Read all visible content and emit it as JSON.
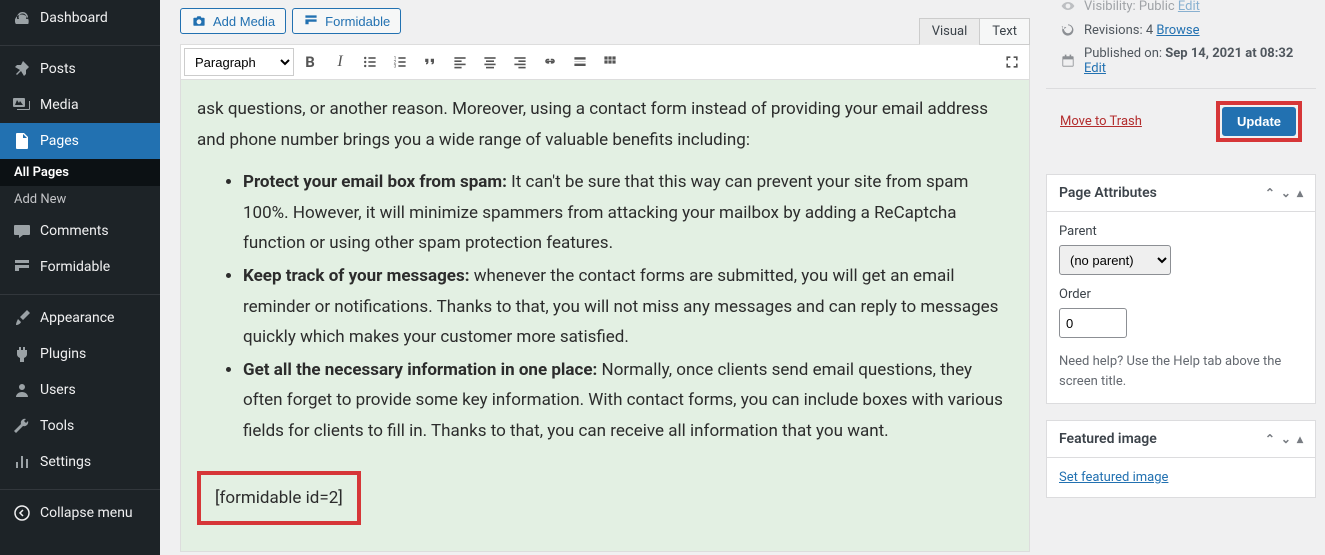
{
  "sidebar": {
    "items": [
      {
        "label": "Dashboard",
        "icon": "dashboard"
      },
      {
        "label": "Posts",
        "icon": "pin"
      },
      {
        "label": "Media",
        "icon": "media"
      },
      {
        "label": "Pages",
        "icon": "pages",
        "active": true
      },
      {
        "label": "Comments",
        "icon": "comment"
      },
      {
        "label": "Formidable",
        "icon": "formidable"
      },
      {
        "label": "Appearance",
        "icon": "brush"
      },
      {
        "label": "Plugins",
        "icon": "plug"
      },
      {
        "label": "Users",
        "icon": "user"
      },
      {
        "label": "Tools",
        "icon": "wrench"
      },
      {
        "label": "Settings",
        "icon": "settings"
      },
      {
        "label": "Collapse menu",
        "icon": "collapse"
      }
    ],
    "submenu": [
      "All Pages",
      "Add New"
    ]
  },
  "editor": {
    "add_media_label": "Add Media",
    "formidable_label": "Formidable",
    "tabs": {
      "visual": "Visual",
      "text": "Text"
    },
    "format_select": "Paragraph",
    "content": {
      "intro": "ask questions, or another reason. Moreover, using a contact form instead of providing your email address and phone number brings you a wide range of valuable benefits including:",
      "bullets": [
        {
          "bold": "Protect your email box from spam:",
          "text": " It can't be sure that this way can prevent your site from spam 100%. However, it will minimize spammers from attacking your mailbox by adding a ReCaptcha function or using other spam protection features."
        },
        {
          "bold": "Keep track of your messages:",
          "text": " whenever the contact forms are submitted, you will get an email reminder or notifications. Thanks to that, you will not miss any messages and can reply to messages quickly which makes your customer more satisfied."
        },
        {
          "bold": "Get all the necessary information in one place:",
          "text": " Normally, once clients send email questions, they often forget to provide some key information. With contact forms, you can include boxes with various fields for clients to fill in. Thanks to that, you can receive all information that you want."
        }
      ],
      "shortcode": "[formidable id=2]"
    }
  },
  "publish": {
    "visibility_label": "Visibility: ",
    "visibility_value": "Public",
    "edit_link": "Edit",
    "revisions_label": "Revisions: ",
    "revisions_count": "4",
    "browse_link": "Browse",
    "published_label": "Published on: ",
    "published_date": "Sep 14, 2021 at 08:32",
    "trash_label": "Move to Trash",
    "update_label": "Update"
  },
  "attributes": {
    "title": "Page Attributes",
    "parent_label": "Parent",
    "parent_value": "(no parent)",
    "order_label": "Order",
    "order_value": "0",
    "help_text": "Need help? Use the Help tab above the screen title."
  },
  "featured": {
    "title": "Featured image",
    "link": "Set featured image"
  }
}
